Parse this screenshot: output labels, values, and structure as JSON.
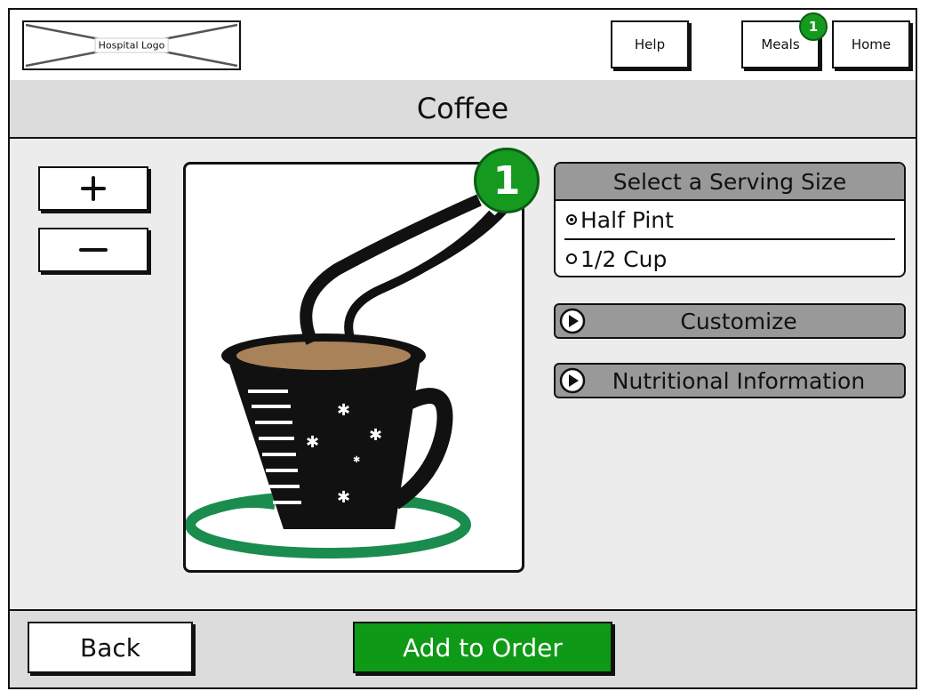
{
  "header": {
    "logo_label": "Hospital Logo",
    "nav": {
      "help": "Help",
      "meals": "Meals",
      "meals_badge": "1",
      "home": "Home"
    }
  },
  "page_title": "Coffee",
  "quantity": {
    "plus_icon": "plus-icon",
    "minus_icon": "minus-icon"
  },
  "item_image": {
    "icon": "coffee-cup-image",
    "badge": "1"
  },
  "serving_size": {
    "heading": "Select a Serving Size",
    "options": [
      {
        "label": "Half Pint",
        "selected": true
      },
      {
        "label": "1/2 Cup",
        "selected": false
      }
    ]
  },
  "sections": {
    "customize": "Customize",
    "nutrition": "Nutritional Information"
  },
  "footer": {
    "back": "Back",
    "add_to_order": "Add to Order"
  },
  "colors": {
    "accent_green": "#0e9a16",
    "badge_green": "#159a1f",
    "panel_gray": "#999999",
    "bar_gray": "#dcdcdc",
    "saucer_green": "#1a8c4e",
    "coffee_brown": "#a9825a"
  }
}
